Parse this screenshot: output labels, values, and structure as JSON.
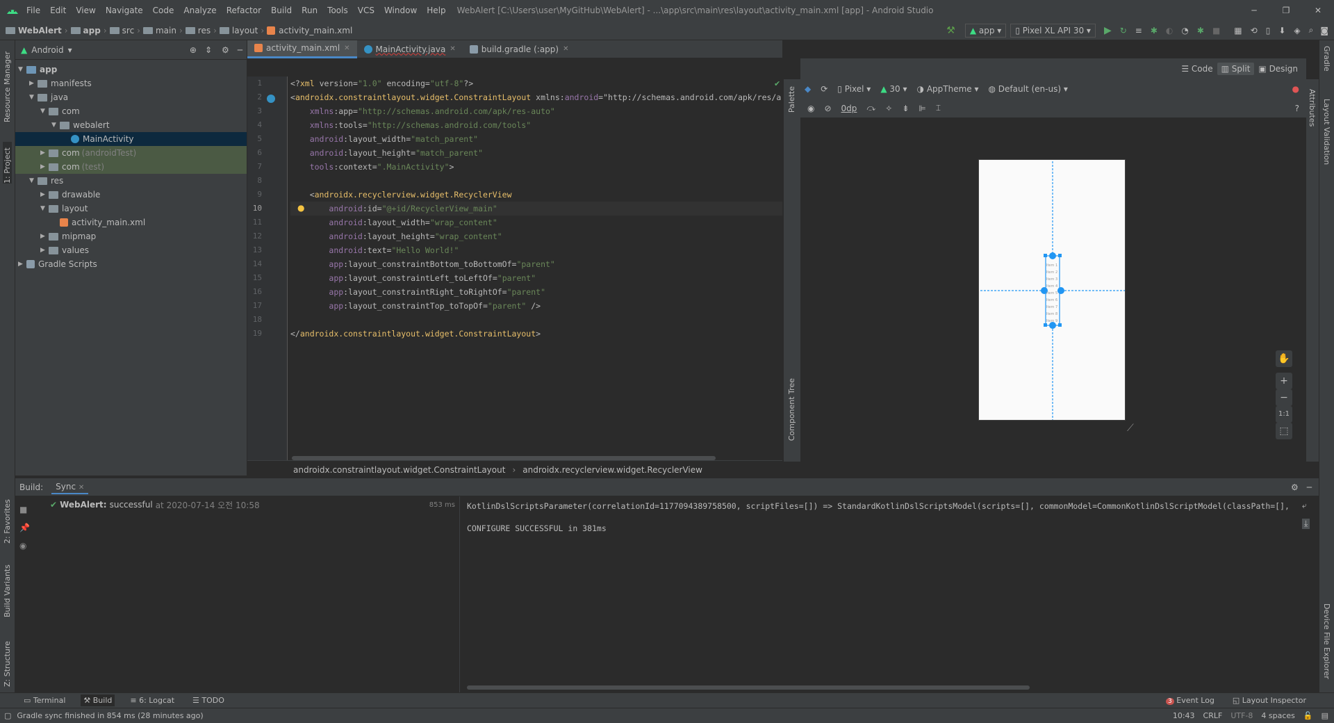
{
  "window": {
    "title": "WebAlert [C:\\Users\\user\\MyGitHub\\WebAlert] - ...\\app\\src\\main\\res\\layout\\activity_main.xml [app] - Android Studio"
  },
  "menu": [
    "File",
    "Edit",
    "View",
    "Navigate",
    "Code",
    "Analyze",
    "Refactor",
    "Build",
    "Run",
    "Tools",
    "VCS",
    "Window",
    "Help"
  ],
  "breadcrumb": [
    "WebAlert",
    "app",
    "src",
    "main",
    "res",
    "layout",
    "activity_main.xml"
  ],
  "toolbar": {
    "run_config": "app",
    "device": "Pixel XL API 30"
  },
  "left_tools": {
    "resource_manager": "Resource Manager",
    "project": "1: Project",
    "favorites": "2: Favorites",
    "build_variants": "Build Variants",
    "structure": "Z: Structure"
  },
  "right_tools": {
    "gradle": "Gradle",
    "layout_validation": "Layout Validation",
    "attributes": "Attributes",
    "device_file_explorer": "Device File Explorer"
  },
  "project": {
    "view": "Android",
    "tree": [
      {
        "label": "app",
        "depth": 0,
        "kind": "module",
        "open": true
      },
      {
        "label": "manifests",
        "depth": 1,
        "kind": "folder",
        "open": false
      },
      {
        "label": "java",
        "depth": 1,
        "kind": "folder",
        "open": true
      },
      {
        "label": "com",
        "depth": 2,
        "kind": "folder",
        "open": true
      },
      {
        "label": "webalert",
        "depth": 3,
        "kind": "folder",
        "open": true
      },
      {
        "label": "MainActivity",
        "depth": 4,
        "kind": "class",
        "selected": true
      },
      {
        "label": "com",
        "suffix": "(androidTest)",
        "depth": 2,
        "kind": "folder",
        "open": false,
        "hl": true
      },
      {
        "label": "com",
        "suffix": "(test)",
        "depth": 2,
        "kind": "folder",
        "open": false,
        "hl": true
      },
      {
        "label": "res",
        "depth": 1,
        "kind": "folder",
        "open": true
      },
      {
        "label": "drawable",
        "depth": 2,
        "kind": "folder",
        "open": false
      },
      {
        "label": "layout",
        "depth": 2,
        "kind": "folder",
        "open": true
      },
      {
        "label": "activity_main.xml",
        "depth": 3,
        "kind": "xml"
      },
      {
        "label": "mipmap",
        "depth": 2,
        "kind": "folder",
        "open": false
      },
      {
        "label": "values",
        "depth": 2,
        "kind": "folder",
        "open": false
      },
      {
        "label": "Gradle Scripts",
        "depth": 0,
        "kind": "gradle",
        "open": false
      }
    ]
  },
  "tabs": [
    {
      "label": "activity_main.xml",
      "active": true
    },
    {
      "label": "MainActivity.java",
      "active": false
    },
    {
      "label": "build.gradle (:app)",
      "active": false
    }
  ],
  "code": {
    "current_line": 10,
    "lines": [
      "<?xml version=\"1.0\" encoding=\"utf-8\"?>",
      "<androidx.constraintlayout.widget.ConstraintLayout xmlns:android=\"http://schemas.android.com/apk/res/a",
      "    xmlns:app=\"http://schemas.android.com/apk/res-auto\"",
      "    xmlns:tools=\"http://schemas.android.com/tools\"",
      "    android:layout_width=\"match_parent\"",
      "    android:layout_height=\"match_parent\"",
      "    tools:context=\".MainActivity\">",
      "",
      "    <androidx.recyclerview.widget.RecyclerView",
      "        android:id=\"@+id/RecyclerView_main\"",
      "        android:layout_width=\"wrap_content\"",
      "        android:layout_height=\"wrap_content\"",
      "        android:text=\"Hello World!\"",
      "        app:layout_constraintBottom_toBottomOf=\"parent\"",
      "        app:layout_constraintLeft_toLeftOf=\"parent\"",
      "        app:layout_constraintRight_toRightOf=\"parent\"",
      "        app:layout_constraintTop_toTopOf=\"parent\" />",
      "",
      "</androidx.constraintlayout.widget.ConstraintLayout>"
    ]
  },
  "editor_breadcrumb": [
    "androidx.constraintlayout.widget.ConstraintLayout",
    "androidx.recyclerview.widget.RecyclerView"
  ],
  "design": {
    "modes": [
      "Code",
      "Split",
      "Design"
    ],
    "active_mode": "Split",
    "palette": "Palette",
    "component_tree": "Component Tree",
    "device": "Pixel",
    "api": "30",
    "theme": "AppTheme",
    "locale": "Default (en-us)",
    "margin": "0dp",
    "zoom_fit": "1:1",
    "preview_items": [
      "Item 1",
      "Item 2",
      "Item 3",
      "Item 4",
      "Item 5",
      "Item 6",
      "Item 7",
      "Item 8",
      "Item 9"
    ],
    "accent": "#2196f3"
  },
  "build": {
    "label": "Build:",
    "tab": "Sync",
    "project": "WebAlert:",
    "status": "successful",
    "time_text": "at 2020-07-14 오전 10:58",
    "duration": "853 ms",
    "output": [
      "KotlinDslScriptsParameter(correlationId=1177094389758500, scriptFiles=[]) => StandardKotlinDslScriptsModel(scripts=[], commonModel=CommonKotlinDslScriptModel(classPath=[],",
      "",
      "CONFIGURE SUCCESSFUL in 381ms"
    ]
  },
  "bottom_tabs": {
    "left": [
      "Terminal",
      "Build",
      "6: Logcat",
      "TODO"
    ],
    "active": "Build",
    "right": [
      "Event Log",
      "Layout Inspector"
    ],
    "event_count": "3"
  },
  "status": {
    "message": "Gradle sync finished in 854 ms (28 minutes ago)",
    "position": "10:43",
    "line_sep": "CRLF",
    "encoding": "UTF-8",
    "indent": "4 spaces"
  }
}
